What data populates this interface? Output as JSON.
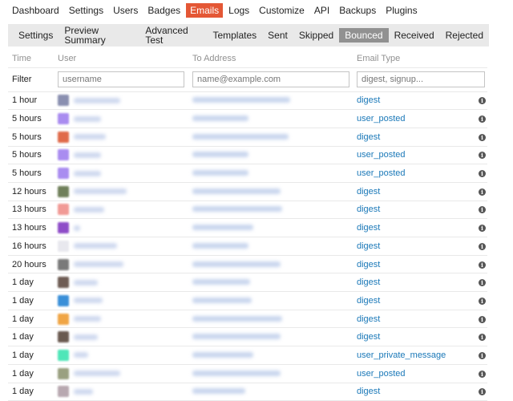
{
  "top_nav": [
    {
      "label": "Dashboard",
      "active": false
    },
    {
      "label": "Settings",
      "active": false
    },
    {
      "label": "Users",
      "active": false
    },
    {
      "label": "Badges",
      "active": false
    },
    {
      "label": "Emails",
      "active": true
    },
    {
      "label": "Logs",
      "active": false
    },
    {
      "label": "Customize",
      "active": false
    },
    {
      "label": "API",
      "active": false
    },
    {
      "label": "Backups",
      "active": false
    },
    {
      "label": "Plugins",
      "active": false
    }
  ],
  "sub_nav": [
    {
      "label": "Settings",
      "active": false
    },
    {
      "label": "Preview Summary",
      "active": false
    },
    {
      "label": "Advanced Test",
      "active": false
    },
    {
      "label": "Templates",
      "active": false
    },
    {
      "label": "Sent",
      "active": false
    },
    {
      "label": "Skipped",
      "active": false
    },
    {
      "label": "Bounced",
      "active": true
    },
    {
      "label": "Received",
      "active": false
    },
    {
      "label": "Rejected",
      "active": false
    }
  ],
  "table": {
    "headers": {
      "time": "Time",
      "user": "User",
      "to": "To Address",
      "type": "Email Type"
    },
    "filter": {
      "label": "Filter",
      "user_placeholder": "username",
      "to_placeholder": "name@example.com",
      "type_placeholder": "digest, signup..."
    },
    "rows": [
      {
        "time": "1 hour",
        "avatar_color": "#8a8fb0",
        "type": "digest"
      },
      {
        "time": "5 hours",
        "avatar_color": "#a98cf0",
        "type": "user_posted"
      },
      {
        "time": "5 hours",
        "avatar_color": "#e06a4a",
        "type": "digest"
      },
      {
        "time": "5 hours",
        "avatar_color": "#a98cf0",
        "type": "user_posted"
      },
      {
        "time": "5 hours",
        "avatar_color": "#a98cf0",
        "type": "user_posted"
      },
      {
        "time": "12 hours",
        "avatar_color": "#6f7f5a",
        "type": "digest"
      },
      {
        "time": "13 hours",
        "avatar_color": "#f19a96",
        "type": "digest"
      },
      {
        "time": "13 hours",
        "avatar_color": "#8e4cc8",
        "type": "digest"
      },
      {
        "time": "16 hours",
        "avatar_color": "#e8e8ee",
        "type": "digest"
      },
      {
        "time": "20 hours",
        "avatar_color": "#7a7a7a",
        "type": "digest"
      },
      {
        "time": "1 day",
        "avatar_color": "#6e5c54",
        "type": "digest"
      },
      {
        "time": "1 day",
        "avatar_color": "#3a8fd8",
        "type": "digest"
      },
      {
        "time": "1 day",
        "avatar_color": "#f0a545",
        "type": "digest"
      },
      {
        "time": "1 day",
        "avatar_color": "#6a5a50",
        "type": "digest"
      },
      {
        "time": "1 day",
        "avatar_color": "#4fe6b8",
        "type": "user_private_message"
      },
      {
        "time": "1 day",
        "avatar_color": "#9aa080",
        "type": "user_posted"
      },
      {
        "time": "1 day",
        "avatar_color": "#b8a8b0",
        "type": "digest"
      }
    ]
  },
  "colors": {
    "accent": "#e45735",
    "link": "#1a78b8",
    "subnav_bg": "#e9e9e9",
    "subnav_active": "#919191"
  },
  "icons": {
    "info": "info-circle-icon"
  }
}
